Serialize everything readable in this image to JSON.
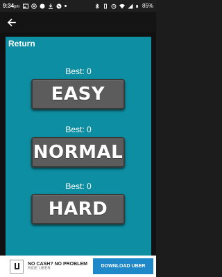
{
  "status_bar": {
    "time": "9:34",
    "time_suffix": "pm",
    "battery": "85%"
  },
  "app_bar": {
    "back_icon": "arrow-left-icon"
  },
  "panel": {
    "return_label": "Return",
    "modes": [
      {
        "best": "Best: 0",
        "label": "EASY"
      },
      {
        "best": "Best: 0",
        "label": "NORMAL"
      },
      {
        "best": "Best: 0",
        "label": "HARD"
      }
    ],
    "background": "#0e8ea2"
  },
  "ad": {
    "headline": "NO CASH? NO PROBLEM",
    "subline": "RIDE UBER",
    "cta": "DOWNLOAD UBER"
  }
}
